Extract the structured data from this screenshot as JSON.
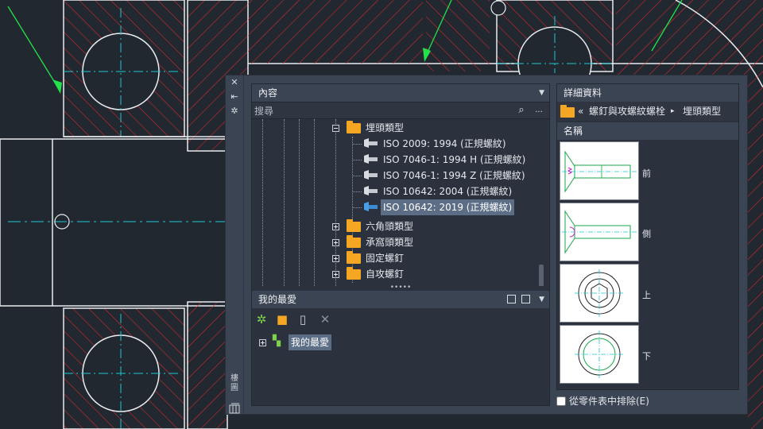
{
  "colors": {
    "accent_red": "#e0282e",
    "centerline_cyan": "#19c8d4",
    "arrow_green": "#22e14a",
    "folder": "#f5a623",
    "selection": "#5c6d86"
  },
  "sidebar": {
    "close_icon": "✕",
    "pin_icon": "⇤",
    "settings_icon": "✲",
    "vertical_label": "樓圖"
  },
  "content": {
    "title": "內容",
    "search_placeholder": "搜尋",
    "more_label": "...",
    "tree": [
      {
        "label": "埋頭類型",
        "type": "folder",
        "expanded": true
      },
      {
        "label": "ISO 2009: 1994 (正規螺紋)",
        "type": "part"
      },
      {
        "label": "ISO 7046-1: 1994 H  (正規螺紋)",
        "type": "part"
      },
      {
        "label": "ISO 7046-1: 1994 Z  (正規螺紋)",
        "type": "part"
      },
      {
        "label": "ISO 10642: 2004 (正規螺紋)",
        "type": "part"
      },
      {
        "label": "ISO 10642: 2019 (正規螺紋)",
        "type": "part",
        "selected": true
      },
      {
        "label": "六角頭類型",
        "type": "folder"
      },
      {
        "label": "承窩頭類型",
        "type": "folder"
      },
      {
        "label": "固定螺釘",
        "type": "folder"
      },
      {
        "label": "自攻螺釘",
        "type": "folder"
      }
    ]
  },
  "favorites": {
    "title": "我的最愛",
    "splitter": "•••••",
    "item": "我的最愛"
  },
  "details": {
    "title": "詳細資料",
    "breadcrumb_back": "«",
    "breadcrumb_parent": "螺釘與攻螺紋螺栓",
    "breadcrumb_sep": "▸",
    "breadcrumb_current": "埋頭類型",
    "name_header": "名稱",
    "views": [
      "前",
      "側",
      "上",
      "下"
    ],
    "exclude_label": "從零件表中排除(E)"
  }
}
